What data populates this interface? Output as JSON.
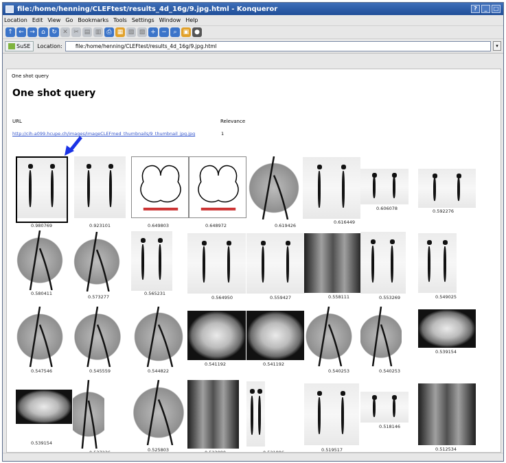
{
  "window": {
    "title": "file:/home/henning/CLEFtest/results_4d_16g/9.jpg.html - Konqueror",
    "controls": [
      "?",
      "_",
      "□"
    ]
  },
  "menu": [
    "Location",
    "Edit",
    "View",
    "Go",
    "Bookmarks",
    "Tools",
    "Settings",
    "Window",
    "Help"
  ],
  "location_bar": {
    "profile_label": "SuSE",
    "label": "Location:",
    "url": "file:/home/henning/CLEFtest/results_4d_16g/9.jpg.html"
  },
  "page": {
    "breadcrumb": "One shot query",
    "title": "One shot query",
    "col_url": "URL",
    "col_relevance": "Relevance",
    "query_link": "http://cih-a099.hcupe.ch/images/imageCLEFmed_thumbnails/9_thumbnail_jpg.jpg",
    "query_relevance": "1"
  },
  "results": [
    {
      "score": "0.980769",
      "kind": "bscan"
    },
    {
      "score": "0.923101",
      "kind": "bscan"
    },
    {
      "score": "0.649803",
      "kind": "diagram"
    },
    {
      "score": "0.648972",
      "kind": "diagram"
    },
    {
      "score": "0.619426",
      "kind": "ang"
    },
    {
      "score": "0.616449",
      "kind": "bscan"
    },
    {
      "score": "0.606078",
      "kind": "bscan"
    },
    {
      "score": "0.592276",
      "kind": "bscan"
    },
    {
      "score": "0.580411",
      "kind": "ang"
    },
    {
      "score": "0.573277",
      "kind": "ang"
    },
    {
      "score": "0.565231",
      "kind": "bscan"
    },
    {
      "score": "0.564950",
      "kind": "bscan"
    },
    {
      "score": "0.559427",
      "kind": "bscan"
    },
    {
      "score": "0.558111",
      "kind": "xray"
    },
    {
      "score": "0.553269",
      "kind": "bscan"
    },
    {
      "score": "0.549025",
      "kind": "bscan"
    },
    {
      "score": "0.547546",
      "kind": "ang"
    },
    {
      "score": "0.545559",
      "kind": "ang"
    },
    {
      "score": "0.544822",
      "kind": "ang"
    },
    {
      "score": "0.541192",
      "kind": "ct"
    },
    {
      "score": "0.541192",
      "kind": "ct"
    },
    {
      "score": "0.540253",
      "kind": "ang"
    },
    {
      "score": "0.540253",
      "kind": "ang"
    },
    {
      "score": "0.539154",
      "kind": "ct"
    },
    {
      "score": "0.539154",
      "kind": "ct"
    },
    {
      "score": "0.537236",
      "kind": "ang"
    },
    {
      "score": "0.525803",
      "kind": "ang"
    },
    {
      "score": "0.523080",
      "kind": "xray"
    },
    {
      "score": "0.521886",
      "kind": "bscan"
    },
    {
      "score": "0.519517",
      "kind": "bscan"
    },
    {
      "score": "0.518146",
      "kind": "bscan"
    },
    {
      "score": "0.512534",
      "kind": "xray"
    }
  ]
}
